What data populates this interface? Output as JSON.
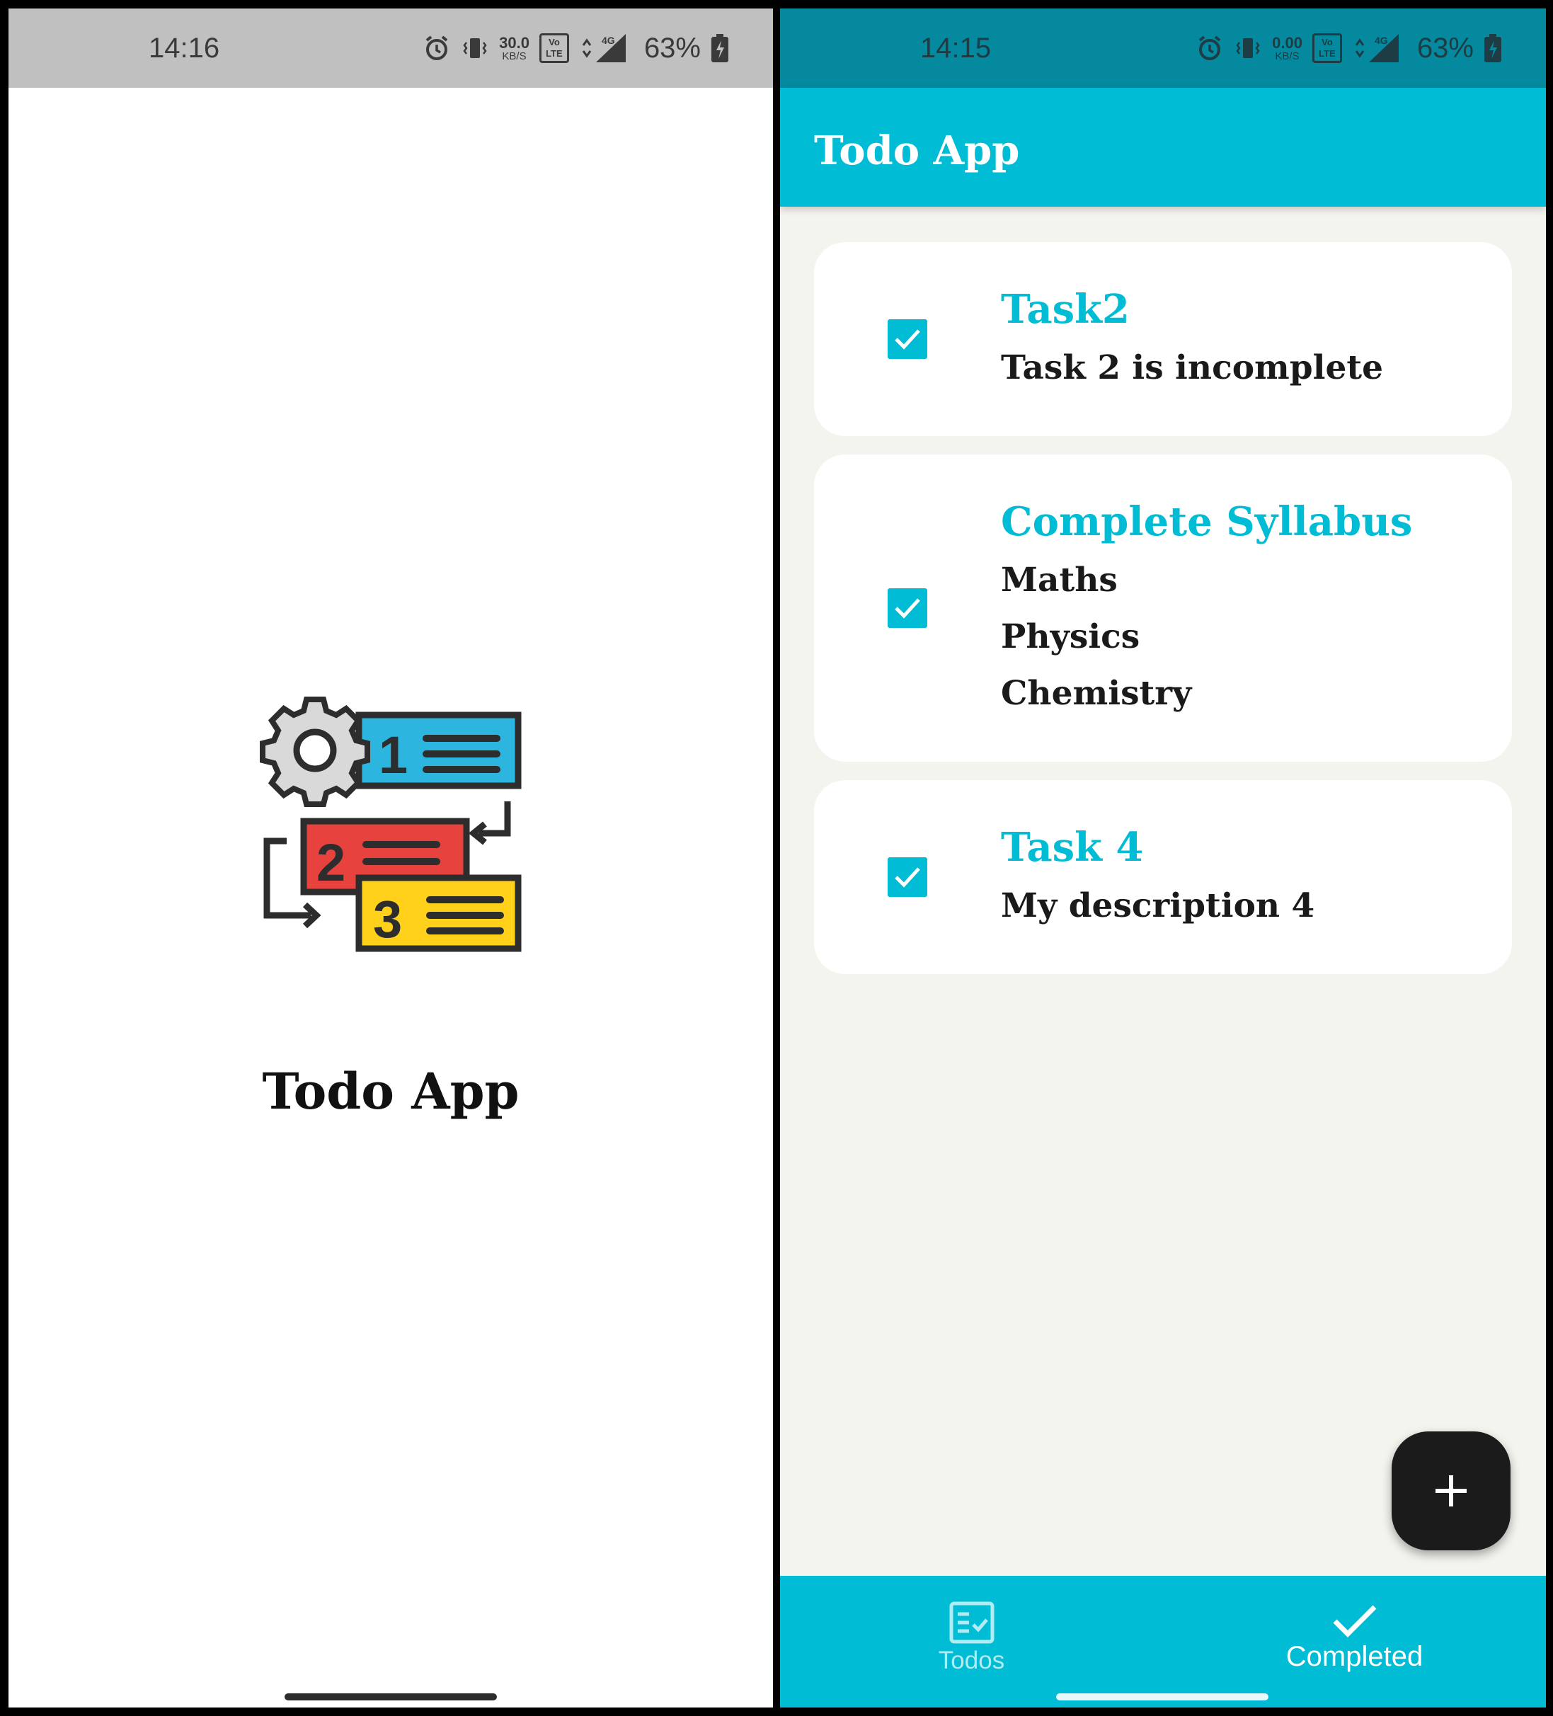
{
  "splash": {
    "status_time": "14:16",
    "net_speed_value": "30.0",
    "net_speed_unit": "KB/S",
    "volte_label": "Vo LTE",
    "network_type": "4G",
    "battery_percent": "63%",
    "logo_numbers": [
      "1",
      "2",
      "3"
    ],
    "app_title": "Todo App"
  },
  "main": {
    "status_time": "14:15",
    "net_speed_value": "0.00",
    "net_speed_unit": "KB/S",
    "volte_label": "Vo LTE",
    "network_type": "4G",
    "battery_percent": "63%",
    "app_bar_title": "Todo App",
    "tasks": [
      {
        "title": "Task2",
        "description": "Task 2 is incomplete",
        "checked": true
      },
      {
        "title": "Complete Syllabus",
        "description": "Maths\nPhysics\nChemistry",
        "checked": true
      },
      {
        "title": "Task 4",
        "description": "My description 4",
        "checked": true
      }
    ],
    "fab_icon": "plus-icon",
    "bottom_nav": [
      {
        "label": "Todos",
        "icon": "todo-list-icon",
        "active": false
      },
      {
        "label": "Completed",
        "icon": "checkmark-icon",
        "active": true
      }
    ]
  },
  "colors": {
    "accent": "#00bcd4",
    "status_bar_dark": "#05899f",
    "status_bar_gray": "#c0c0c0",
    "fab": "#1b1b1b",
    "background": "#f4f4ef"
  }
}
